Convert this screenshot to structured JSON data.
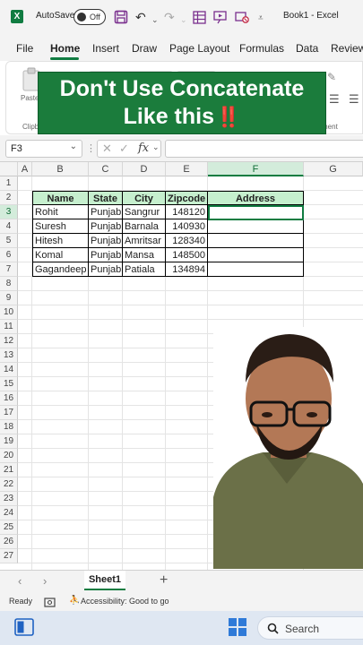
{
  "titlebar": {
    "app_icon": "X",
    "autosave_label": "AutoSave",
    "autosave_state": "Off",
    "doc_title": "Book1  -  Excel"
  },
  "menu": [
    "File",
    "Home",
    "Insert",
    "Draw",
    "Page Layout",
    "Formulas",
    "Data",
    "Review"
  ],
  "ribbon": {
    "paste_label": "Paste",
    "clipboard_label": "Clipb",
    "alignment_label": "ment"
  },
  "banner": {
    "line1": "Don't Use Concatenate",
    "line2": "Like this",
    "emoji": "‼️",
    "color": "#1b7c3c"
  },
  "formula_bar": {
    "name_box": "F3",
    "fx_label": "fx",
    "formula": ""
  },
  "columns": [
    "A",
    "B",
    "C",
    "D",
    "E",
    "F",
    "G"
  ],
  "rows": [
    "1",
    "2",
    "3",
    "4",
    "5",
    "6",
    "7",
    "8",
    "9",
    "10",
    "11",
    "12",
    "13",
    "14",
    "15",
    "16",
    "17",
    "18",
    "19",
    "20",
    "21",
    "22",
    "23",
    "24",
    "25",
    "26",
    "27"
  ],
  "table": {
    "headers": [
      "Name",
      "State",
      "City",
      "Zipcode",
      "Address"
    ],
    "rows": [
      [
        "Rohit",
        "Punjab",
        "Sangrur",
        "148120",
        ""
      ],
      [
        "Suresh",
        "Punjab",
        "Barnala",
        "140930",
        ""
      ],
      [
        "Hitesh",
        "Punjab",
        "Amritsar",
        "128340",
        ""
      ],
      [
        "Komal",
        "Punjab",
        "Mansa",
        "148500",
        ""
      ],
      [
        "Gagandeep",
        "Punjab",
        "Patiala",
        "134894",
        ""
      ]
    ],
    "header_fill": "#c6efce"
  },
  "sheets": [
    "Sheet1"
  ],
  "status": {
    "ready": "Ready",
    "accessibility": "Accessibility: Good to go"
  },
  "taskbar": {
    "search_placeholder": "Search"
  },
  "accent_color": "#107c41"
}
